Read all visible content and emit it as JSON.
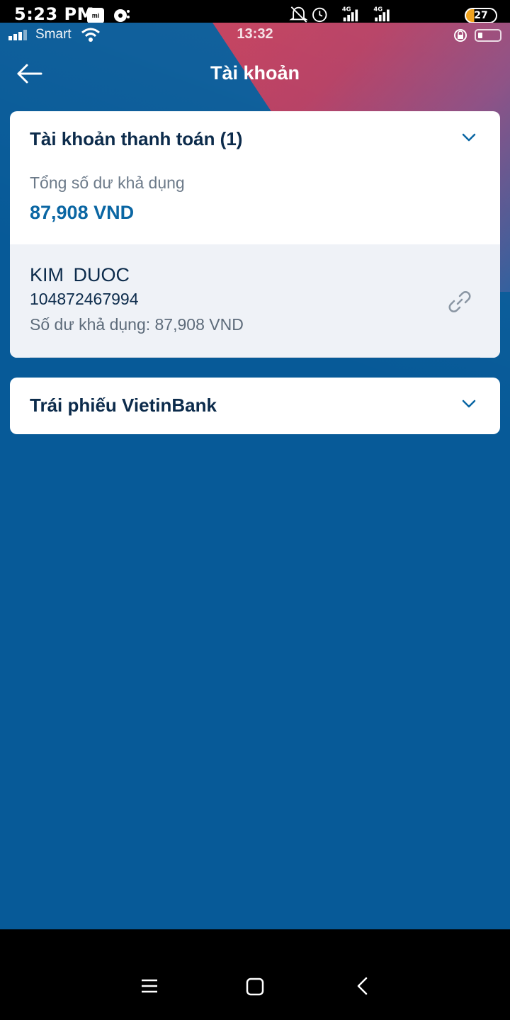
{
  "android_status": {
    "time": "5:23 PM",
    "mi_badge": "mi",
    "battery": "27",
    "network_1": "4G",
    "network_2": "4G"
  },
  "ios_status": {
    "carrier": "Smart",
    "clock": "13:32"
  },
  "header": {
    "title": "Tài khoản"
  },
  "payment_card": {
    "title": "Tài khoản thanh toán (1)",
    "total_label": "Tổng số dư khả dụng",
    "total_value": "87,908 VND",
    "account": {
      "name": "KIM  DUOC",
      "number": "104872467994",
      "balance": "Số dư khả dụng: 87,908 VND"
    }
  },
  "bond_card": {
    "title": "Trái phiếu VietinBank"
  },
  "colors": {
    "app_bg": "#075a98",
    "accent_red": "#c43d5a",
    "title_text": "#0c2b4b",
    "amount_text": "#0a66a3"
  },
  "icons": [
    "back-arrow-icon",
    "chevron-down-icon",
    "link-icon",
    "menu-icon",
    "home-icon",
    "back-icon",
    "wifi-icon",
    "signal-icon",
    "alarm-icon",
    "bell-off-icon"
  ]
}
